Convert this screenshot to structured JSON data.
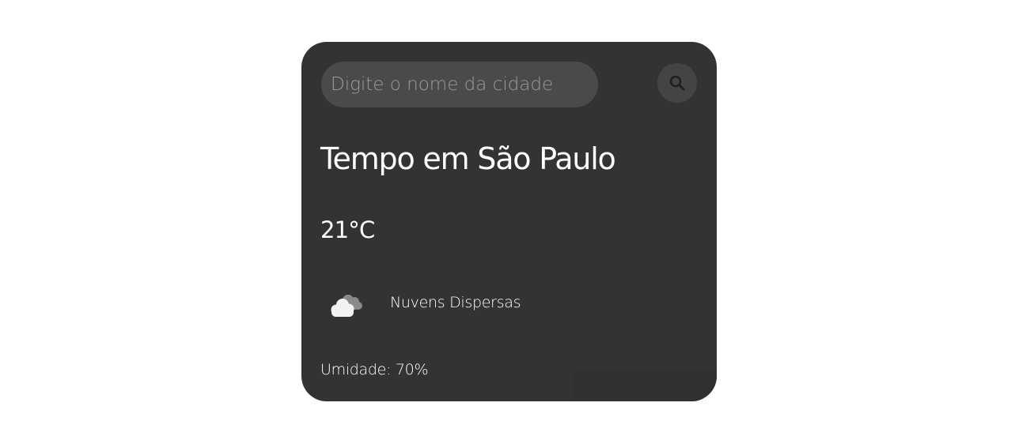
{
  "search": {
    "placeholder": "Digite o nome da cidade",
    "value": "",
    "button_icon": "search-icon"
  },
  "weather": {
    "title": "Tempo em São Paulo",
    "temperature": "21°C",
    "icon": "scattered-clouds-icon",
    "description": "Nuvens Dispersas",
    "humidity": "Umidade: 70%"
  },
  "colors": {
    "page_background": "#ffffff",
    "card_background": "#333333",
    "input_background": "#4a4a4a",
    "button_background": "#444444",
    "text": "#ffffff",
    "placeholder": "#9a9a9a"
  }
}
